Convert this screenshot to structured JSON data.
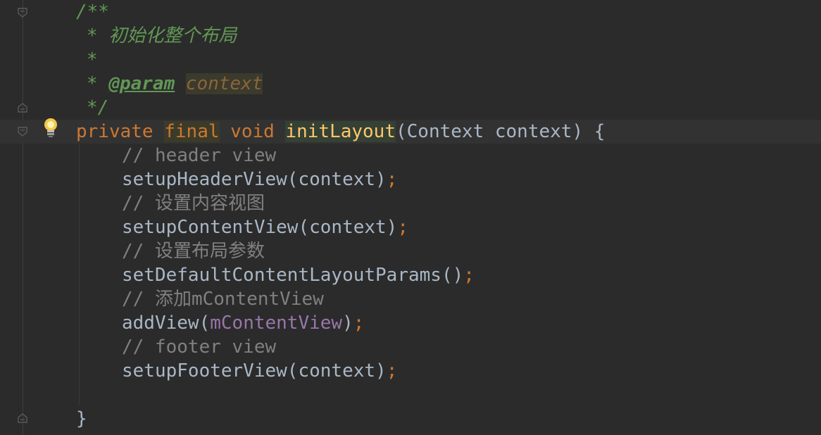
{
  "editor": {
    "language": "java",
    "colors": {
      "background": "#2b2b2b",
      "comment_doc": "#629755",
      "comment_line": "#808080",
      "keyword": "#cc7832",
      "method": "#ffc66d",
      "field": "#9876aa",
      "text": "#a9b7c6"
    },
    "javadoc": {
      "open": "/**",
      "star": "*",
      "description": "初始化整个布局",
      "param_tag": "@param",
      "param_name": "context",
      "close": "*/"
    },
    "signature": {
      "kw_private": "private",
      "kw_final": "final",
      "kw_void": "void",
      "method_name": "initLayout",
      "params": "(Context context) {"
    },
    "body": [
      {
        "comment": "// header view",
        "call": "setupHeaderView(context)"
      },
      {
        "comment": "// 设置内容视图",
        "call": "setupContentView(context)"
      },
      {
        "comment": "// 设置布局参数",
        "call": "setDefaultContentLayoutParams()"
      },
      {
        "comment": "// 添加mContentView",
        "call_pre": "addView(",
        "call_field": "mContentView",
        "call_post": ")"
      },
      {
        "comment": "// footer view",
        "call": "setupFooterView(context)"
      }
    ],
    "semicolon": ";",
    "closing_brace": "}"
  }
}
